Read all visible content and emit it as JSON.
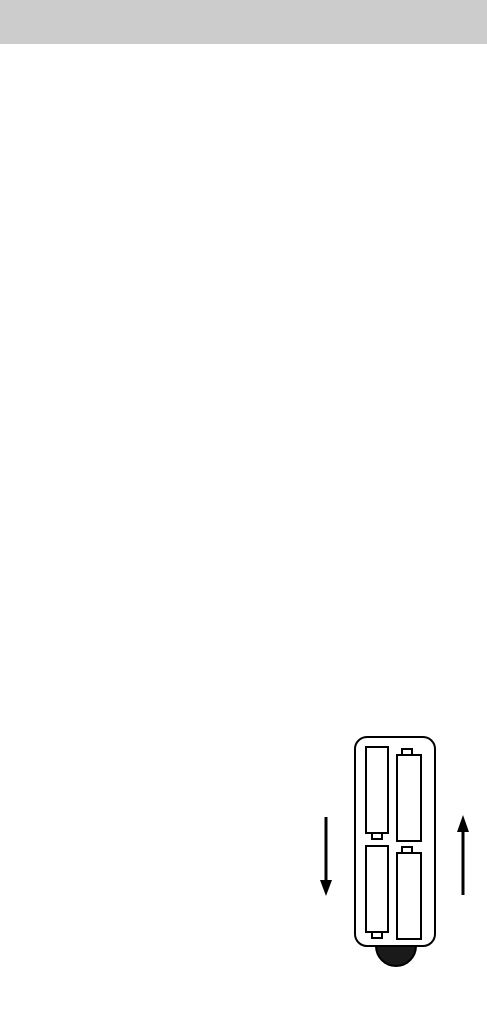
{
  "header": {
    "background_color": "#cccccc"
  },
  "figure": {
    "subject": "battery-compartment",
    "battery_count": 4,
    "insert_direction_left": "down",
    "insert_direction_right": "up",
    "stroke_color": "#000000",
    "knob_color": "#1a1a1a"
  }
}
